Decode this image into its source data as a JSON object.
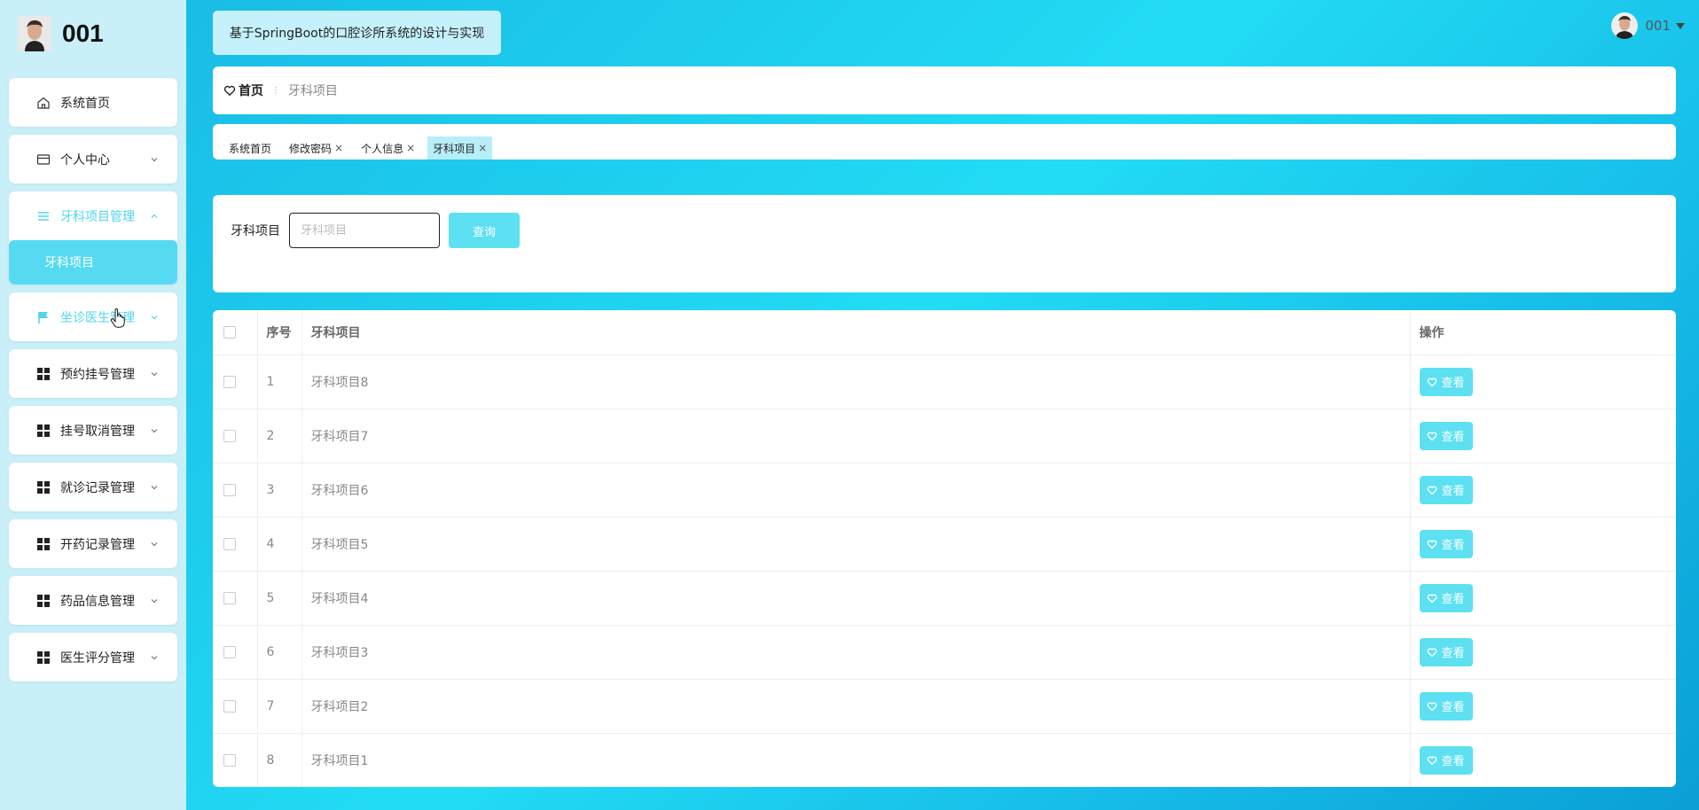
{
  "brand": {
    "name": "001"
  },
  "sidebar": {
    "items": [
      {
        "label": "系统首页",
        "icon": "home-icon"
      },
      {
        "label": "个人中心",
        "icon": "card-icon"
      },
      {
        "label": "牙科项目管理",
        "icon": "list-icon",
        "sub": [
          "牙科项目"
        ]
      },
      {
        "label": "坐诊医生管理",
        "icon": "flag-icon"
      },
      {
        "label": "预约挂号管理",
        "icon": "grid-icon"
      },
      {
        "label": "挂号取消管理",
        "icon": "grid-icon"
      },
      {
        "label": "就诊记录管理",
        "icon": "grid-icon"
      },
      {
        "label": "开药记录管理",
        "icon": "grid-icon"
      },
      {
        "label": "药品信息管理",
        "icon": "grid-icon"
      },
      {
        "label": "医生评分管理",
        "icon": "grid-icon"
      }
    ]
  },
  "header": {
    "system_title": "基于SpringBoot的口腔诊所系统的设计与实现",
    "user": "001"
  },
  "breadcrumb": {
    "home": "首页",
    "separator": "⁝",
    "current": "牙科项目"
  },
  "tabs": [
    {
      "label": "系统首页",
      "closable": false
    },
    {
      "label": "修改密码",
      "closable": true
    },
    {
      "label": "个人信息",
      "closable": true
    },
    {
      "label": "牙科项目",
      "closable": true
    }
  ],
  "search": {
    "label": "牙科项目",
    "placeholder": "牙科项目",
    "button": "查询"
  },
  "table": {
    "headers": {
      "index": "序号",
      "name": "牙科项目",
      "op": "操作"
    },
    "view_label": "查看",
    "rows": [
      {
        "index": "1",
        "name": "牙科项目8"
      },
      {
        "index": "2",
        "name": "牙科项目7"
      },
      {
        "index": "3",
        "name": "牙科项目6"
      },
      {
        "index": "4",
        "name": "牙科项目5"
      },
      {
        "index": "5",
        "name": "牙科项目4"
      },
      {
        "index": "6",
        "name": "牙科项目3"
      },
      {
        "index": "7",
        "name": "牙科项目2"
      },
      {
        "index": "8",
        "name": "牙科项目1"
      }
    ]
  },
  "colors": {
    "accent": "#5ce0f2",
    "sidebar_bg": "#c9eff8",
    "active_text": "#4fd5ef"
  }
}
